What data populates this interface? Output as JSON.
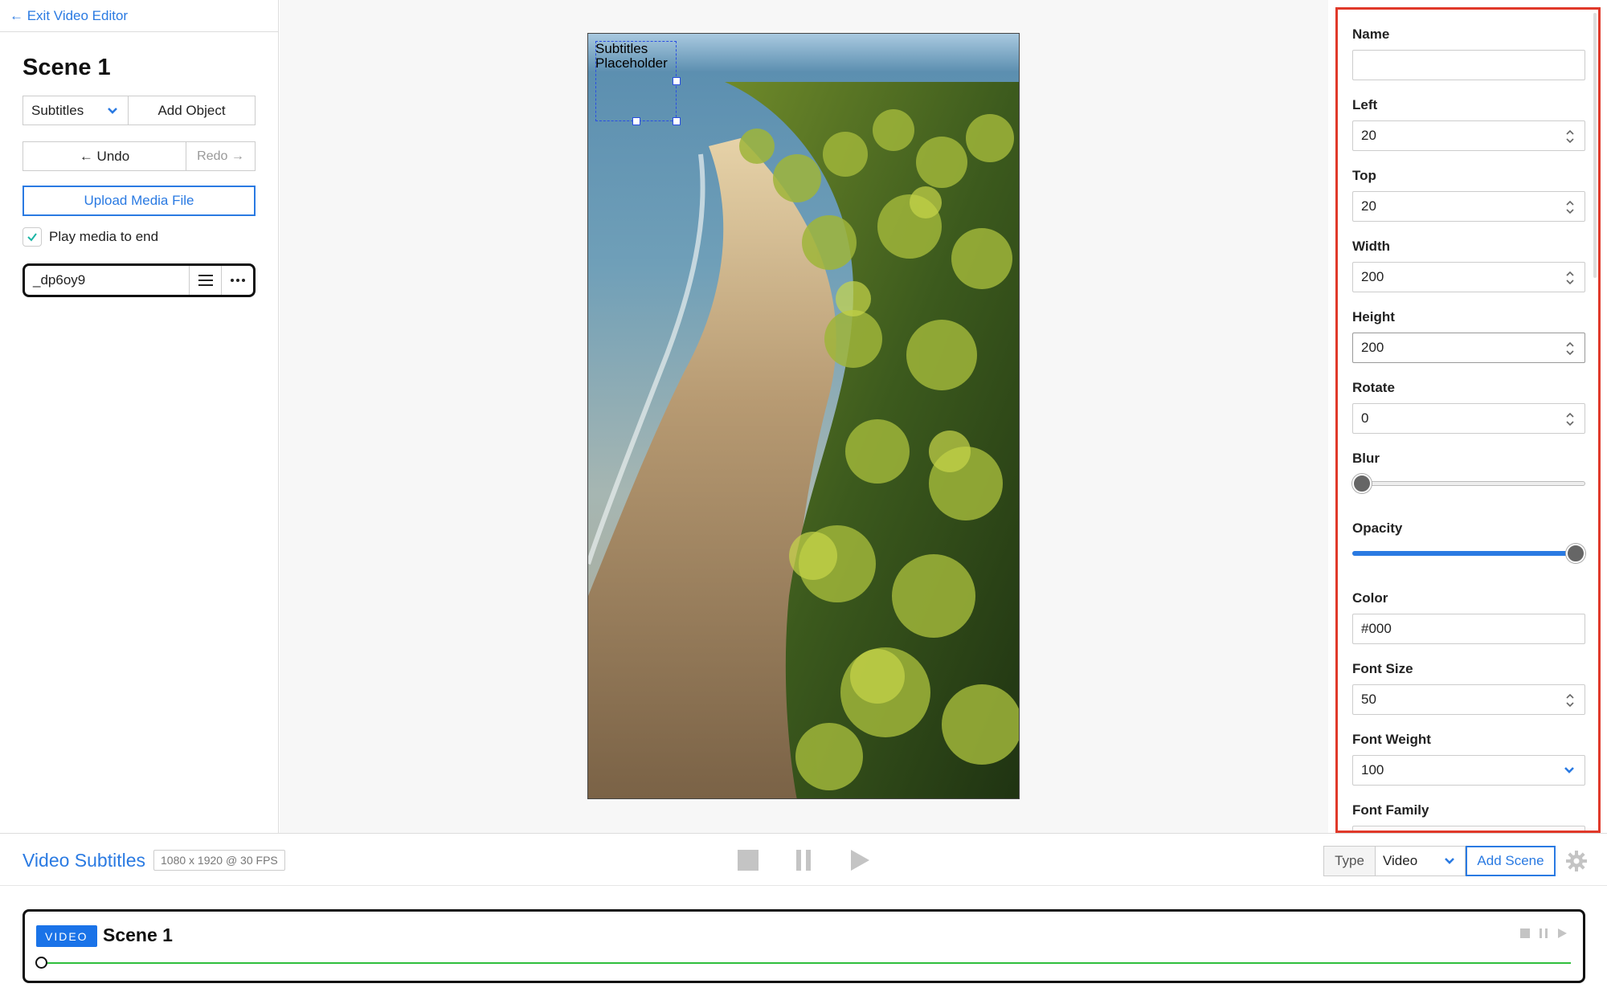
{
  "left_panel": {
    "exit_link": "← Exit Video Editor",
    "scene_title": "Scene 1",
    "subtitles_select": "Subtitles",
    "add_object": "Add Object",
    "undo": "← Undo",
    "redo": "Redo →",
    "upload": "Upload Media File",
    "play_to_end": {
      "label": "Play media to end",
      "checked": true
    },
    "media_item": {
      "name": "_dp6oy9"
    }
  },
  "stage": {
    "subtitle_text": "Subtitles Placeholder"
  },
  "properties": {
    "name": {
      "label": "Name",
      "value": ""
    },
    "left": {
      "label": "Left",
      "value": "20"
    },
    "top": {
      "label": "Top",
      "value": "20"
    },
    "width": {
      "label": "Width",
      "value": "200"
    },
    "height": {
      "label": "Height",
      "value": "200"
    },
    "rotate": {
      "label": "Rotate",
      "value": "0"
    },
    "blur": {
      "label": "Blur",
      "level": 0
    },
    "opacity": {
      "label": "Opacity",
      "level": 1
    },
    "color": {
      "label": "Color",
      "value": "#000"
    },
    "font_size": {
      "label": "Font Size",
      "value": "50"
    },
    "font_weight": {
      "label": "Font Weight",
      "value": "100"
    },
    "font_family": {
      "label": "Font Family"
    }
  },
  "bottom_bar": {
    "project_title": "Video Subtitles",
    "project_meta": "1080 x 1920 @ 30 FPS",
    "type_label": "Type",
    "type_value": "Video",
    "add_scene": "Add Scene"
  },
  "timeline": {
    "scene_badge": "VIDEO",
    "scene_title": "Scene 1"
  },
  "colors": {
    "accent": "#2a7ae2",
    "highlight_border": "#e0392a",
    "progress": "#2fbf3c",
    "badge": "#1a73e8"
  }
}
